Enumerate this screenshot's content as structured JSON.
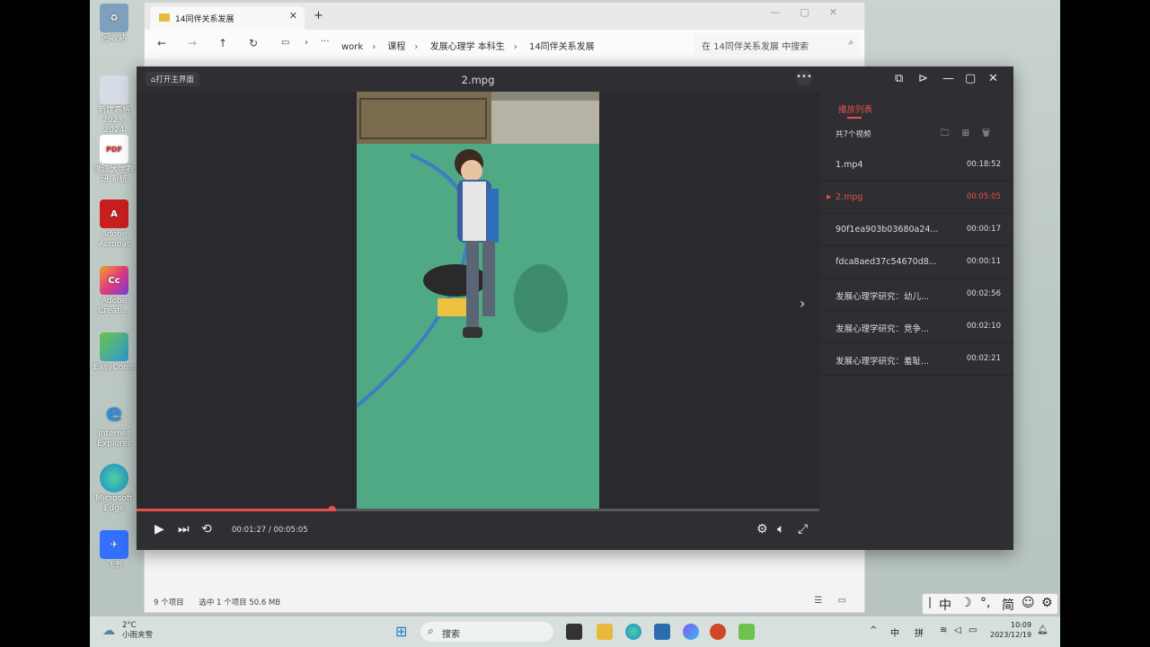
{
  "desktop": {
    "icons": [
      {
        "name": "recycle-bin",
        "label": "回收站",
        "color": "#6b8fb0"
      },
      {
        "name": "new-file",
        "label": "新建表格 2023-2024",
        "color": "#d6dde6"
      },
      {
        "name": "pdf-file",
        "label": "浙江大学教研 系统",
        "color": "#ffffff"
      },
      {
        "name": "acrobat",
        "label": "Adobe Acrobat",
        "color": "#c81e1e"
      },
      {
        "name": "creative-cloud",
        "label": "Adobe Creati...",
        "color": "#e23c7a"
      },
      {
        "name": "easyconnect",
        "label": "EasyConn...",
        "color": "#4caf50"
      },
      {
        "name": "internet-explorer",
        "label": "Internet Explorer",
        "color": "#2b8fd9"
      },
      {
        "name": "edge",
        "label": "Microsoft Edge",
        "color": "#1a8ac8"
      },
      {
        "name": "feishu",
        "label": "飞书",
        "color": "#3370ff"
      }
    ]
  },
  "explorer": {
    "tab_title": "14同伴关系发展",
    "breadcrumbs": [
      "work",
      "课程",
      "发展心理学 本科生",
      "14同伴关系发展"
    ],
    "search_placeholder": "在 14同伴关系发展 中搜索",
    "status_items": "9 个项目",
    "status_selected": "选中 1 个项目  50.6 MB"
  },
  "player": {
    "home_label": "打开主界面",
    "title": "2.mpg",
    "current_time": "00:01:27",
    "total_time": "00:05:05",
    "time_display": "00:01:27 / 00:05:05",
    "progress": 0.285,
    "accent_color": "#e5504a",
    "playlist": {
      "header": "播放列表",
      "count_label": "共7个视频",
      "items": [
        {
          "name": "1.mp4",
          "duration": "00:18:52",
          "active": false
        },
        {
          "name": "2.mpg",
          "duration": "00:05:05",
          "active": true
        },
        {
          "name": "90f1ea903b03680a24...",
          "duration": "00:00:17",
          "active": false
        },
        {
          "name": "fdca8aed37c54670d8...",
          "duration": "00:00:11",
          "active": false
        },
        {
          "name": "发展心理学研究：幼儿...",
          "duration": "00:02:56",
          "active": false
        },
        {
          "name": "发展心理学研究：竞争...",
          "duration": "00:02:10",
          "active": false
        },
        {
          "name": "发展心理学研究：羞耻...",
          "duration": "00:02:21",
          "active": false
        }
      ]
    }
  },
  "taskbar": {
    "weather_temp": "2°C",
    "weather_desc": "小雨夹雪",
    "search_label": "搜索",
    "ime_lang": "中",
    "ime_mode": "拼",
    "time": "10:09",
    "date": "2023/12/19"
  },
  "ime_bar": {
    "chars": [
      "中",
      "简"
    ]
  }
}
